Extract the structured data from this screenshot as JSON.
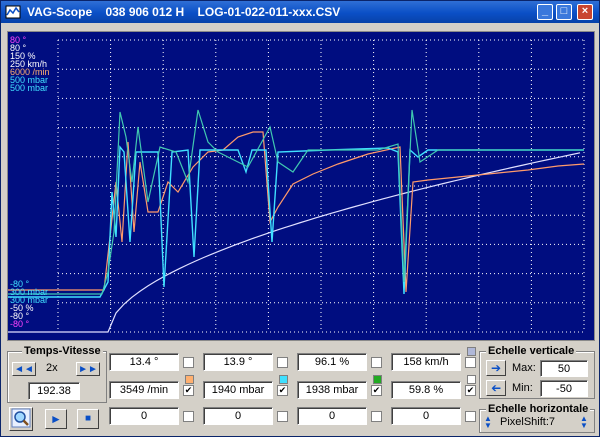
{
  "window": {
    "title": "VAG-Scope    038 906 012 H    LOG-01-022-011-xxx.CSV",
    "minimize_symbol": "_",
    "maximize_symbol": "□",
    "close_symbol": "×"
  },
  "scope": {
    "top_labels": [
      {
        "text": "80 °",
        "color": "#ff44ff"
      },
      {
        "text": "80 °",
        "color": "#ffffff"
      },
      {
        "text": "150 %",
        "color": "#ffffff"
      },
      {
        "text": "250 km/h",
        "color": "#ffffff"
      },
      {
        "text": "6000 /min",
        "color": "#ffb070"
      },
      {
        "text": "500 mbar",
        "color": "#40e0ff"
      },
      {
        "text": "500 mbar",
        "color": "#40e0ff"
      }
    ],
    "bottom_labels": [
      {
        "text": "-80 °",
        "color": "#40e0ff"
      },
      {
        "text": "300 mbar",
        "color": "#40e0ff"
      },
      {
        "text": "300 mbar",
        "color": "#40e0ff"
      },
      {
        "text": "-50 %",
        "color": "#ffffff"
      },
      {
        "text": "-80 °",
        "color": "#ffffff"
      },
      {
        "text": "-80 °",
        "color": "#ff44ff"
      }
    ],
    "colors": {
      "background": "#000d80",
      "grid": "#ffffff",
      "series_cyan": "#40e0ff",
      "series_teal": "#40c8b0",
      "series_orange": "#ff9a6a",
      "series_white": "#e0e0ff"
    }
  },
  "temps_vitesse": {
    "title": "Temps-Vitesse",
    "rewind_icon": "◄◄",
    "speed_label": "2x",
    "forward_icon": "►►",
    "time_value": "192.38",
    "zoom_icon": "magnifier-icon",
    "play_icon": "►",
    "stop_icon": "■"
  },
  "channels": {
    "row1": [
      "13.4 °",
      "13.9 °",
      "96.1 %",
      "158 km/h"
    ],
    "row2": [
      "3549 /min",
      "1940 mbar",
      "1938 mbar",
      "59.8 %"
    ],
    "row3": [
      "0",
      "0",
      "0",
      "0"
    ],
    "row2_swatches": [
      "#ffb070",
      "#40e0ff",
      "#22aa22",
      "#ffffff"
    ],
    "row1_swatch_last": "#b0b8d8"
  },
  "echelle_verticale": {
    "title": "Echelle verticale",
    "max_label": "Max:",
    "max_value": "50",
    "min_label": "Min:",
    "min_value": "-50"
  },
  "echelle_horizontale": {
    "title": "Echelle horizontale",
    "pixelshift": "PixelShift:7"
  }
}
